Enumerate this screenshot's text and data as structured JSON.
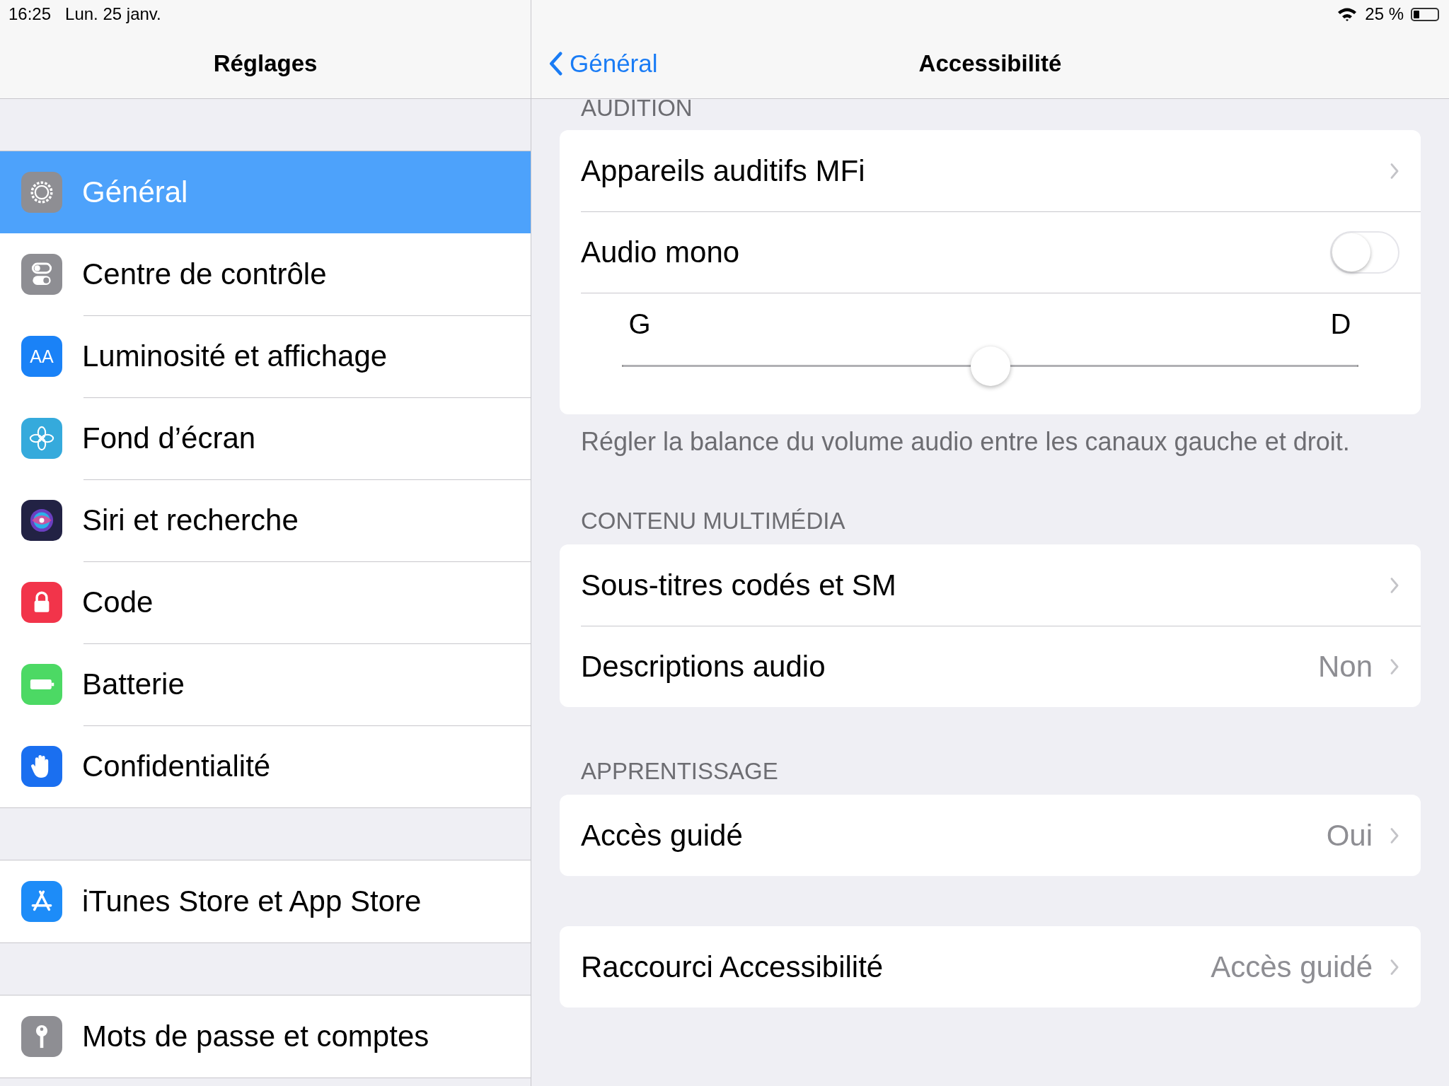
{
  "status_bar": {
    "time": "16:25",
    "date": "Lun. 25 janv.",
    "battery": "25 %"
  },
  "sidebar": {
    "title": "Réglages",
    "groups": [
      {
        "items": [
          {
            "label": "Général",
            "selected": true,
            "color": "#8e8e93"
          },
          {
            "label": "Centre de contrôle",
            "selected": false,
            "color": "#8e8e93"
          },
          {
            "label": "Luminosité et affichage",
            "selected": false,
            "color": "#1a82f7",
            "icon_text": "AA"
          },
          {
            "label": "Fond d’écran",
            "selected": false,
            "color": "#35aadc"
          },
          {
            "label": "Siri et recherche",
            "selected": false,
            "color": "#222244"
          },
          {
            "label": "Code",
            "selected": false,
            "color": "#f2344a"
          },
          {
            "label": "Batterie",
            "selected": false,
            "color": "#4cd964"
          },
          {
            "label": "Confidentialité",
            "selected": false,
            "color": "#1a6ff0"
          }
        ]
      },
      {
        "items": [
          {
            "label": "iTunes Store et App Store",
            "selected": false,
            "color": "#1d8cf8"
          }
        ]
      },
      {
        "items": [
          {
            "label": "Mots de passe et comptes",
            "selected": false,
            "color": "#8e8e93"
          }
        ]
      }
    ]
  },
  "detail": {
    "back": "Général",
    "title": "Accessibilité",
    "sections": [
      {
        "header": "AUDITION",
        "rows": [
          {
            "kind": "link",
            "label": "Appareils auditifs MFi"
          },
          {
            "kind": "toggle",
            "label": "Audio mono",
            "on": false
          },
          {
            "kind": "slider",
            "left": "G",
            "right": "D",
            "level": 0.5
          }
        ],
        "footer": "Régler la balance du volume audio entre les canaux gauche et droit."
      },
      {
        "header": "CONTENU MULTIMÉDIA",
        "rows": [
          {
            "kind": "link",
            "label": "Sous-titres codés et SM"
          },
          {
            "kind": "link",
            "label": "Descriptions audio",
            "value": "Non"
          }
        ]
      },
      {
        "header": "APPRENTISSAGE",
        "rows": [
          {
            "kind": "link",
            "label": "Accès guidé",
            "value": "Oui"
          }
        ]
      },
      {
        "rows": [
          {
            "kind": "link",
            "label": "Raccourci Accessibilité",
            "value": "Accès guidé"
          }
        ]
      }
    ]
  }
}
